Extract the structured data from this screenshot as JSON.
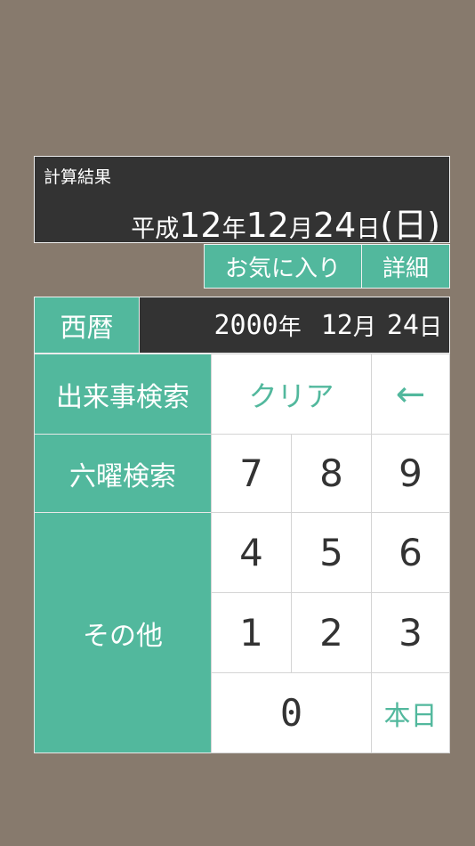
{
  "result": {
    "label": "計算結果",
    "era": "平成",
    "year": "12",
    "year_unit": "年",
    "month": "12",
    "month_unit": "月",
    "day": "24",
    "day_unit": "日",
    "weekday_open": "(",
    "weekday": "日",
    "weekday_close": ")"
  },
  "actions": {
    "favorite_label": "お気に入り",
    "detail_label": "詳細"
  },
  "input": {
    "calendar_type": "西暦",
    "year": "2000",
    "year_unit": "年",
    "month": "12",
    "month_unit": "月",
    "day": "24",
    "day_unit": "日"
  },
  "side": {
    "event_search": "出来事検索",
    "rokuyo_search": "六曜検索",
    "other": "その他"
  },
  "keypad": {
    "clear": "クリア",
    "backspace": "←",
    "k7": "7",
    "k8": "8",
    "k9": "9",
    "k4": "4",
    "k5": "5",
    "k6": "6",
    "k1": "1",
    "k2": "2",
    "k3": "3",
    "k0": "0",
    "today": "本日"
  },
  "colors": {
    "background": "#877a6d",
    "accent": "#52b89d",
    "dark_panel": "#333333",
    "key_bg": "#ffffff"
  }
}
